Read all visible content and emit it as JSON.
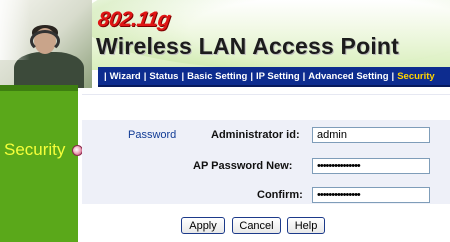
{
  "header": {
    "model": "802.11g",
    "product_title": "Wireless LAN Access Point"
  },
  "nav": {
    "items": [
      {
        "label": "Wizard",
        "active": false
      },
      {
        "label": "Status",
        "active": false
      },
      {
        "label": "Basic Setting",
        "active": false
      },
      {
        "label": "IP Setting",
        "active": false
      },
      {
        "label": "Advanced Setting",
        "active": false
      },
      {
        "label": "Security",
        "active": true
      }
    ]
  },
  "sidebar": {
    "section_title": "Security"
  },
  "form": {
    "tab_label": "Password",
    "admin_id_label": "Administrator id:",
    "admin_id_value": "admin",
    "new_password_label": "AP Password New:",
    "new_password_value": "•••••••••••••••",
    "confirm_label": "Confirm:",
    "confirm_value": "•••••••••••••••"
  },
  "buttons": {
    "apply": "Apply",
    "cancel": "Cancel",
    "help": "Help"
  },
  "colors": {
    "nav_bg": "#0d2c8f",
    "nav_active": "#ffd400",
    "sidebar_green": "#5aa81a",
    "section_title": "#f5ff3a",
    "model_red": "#e01515"
  }
}
